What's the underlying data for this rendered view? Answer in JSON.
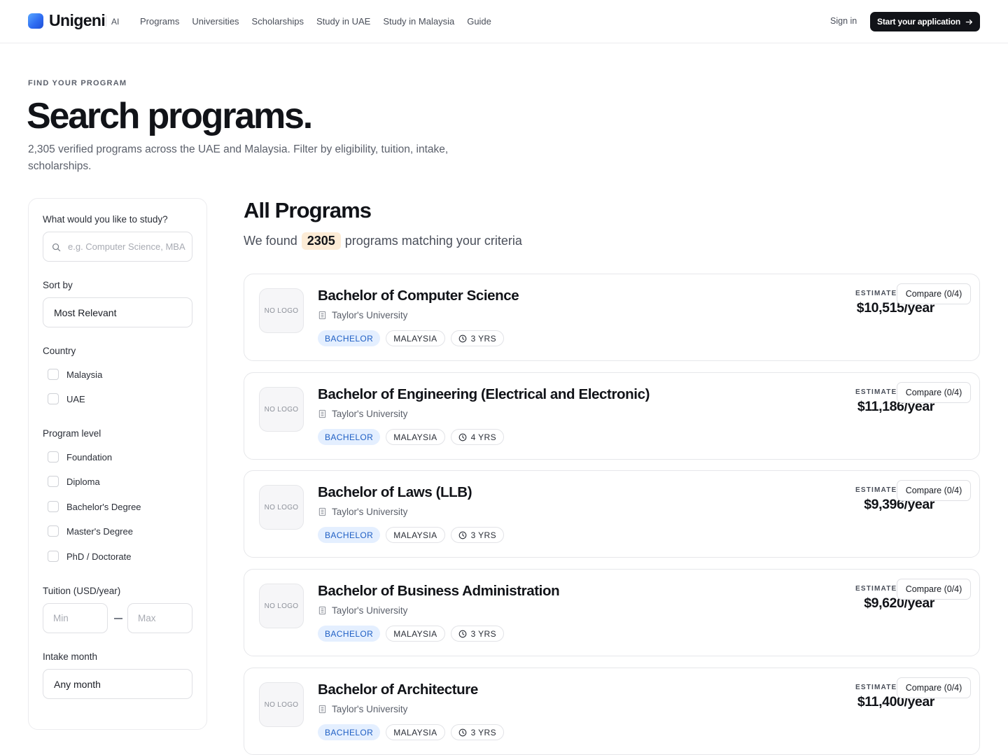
{
  "nav": {
    "brand": "Unigeni",
    "brand_suffix": "AI",
    "links": [
      "Programs",
      "Universities",
      "Scholarships",
      "Study in UAE",
      "Study in Malaysia",
      "Guide"
    ],
    "sign_in": "Sign in",
    "cta": "Start your application"
  },
  "hero": {
    "eyebrow": "FIND YOUR PROGRAM",
    "title": "Search programs.",
    "subtitle": "2,305 verified programs across the UAE and Malaysia. Filter by eligibility, tuition, intake, scholarships."
  },
  "filters": {
    "study_label": "What would you like to study?",
    "study_placeholder": "e.g. Computer Science, MBA",
    "sort_label": "Sort by",
    "sort_value": "Most Relevant",
    "country_label": "Country",
    "countries": [
      "Malaysia",
      "UAE"
    ],
    "level_label": "Program level",
    "levels": [
      "Foundation",
      "Diploma",
      "Bachelor's Degree",
      "Master's Degree",
      "PhD / Doctorate"
    ],
    "tuition_label": "Tuition (USD/year)",
    "tuition_min_placeholder": "Min",
    "tuition_max_placeholder": "Max",
    "intake_label": "Intake month",
    "intake_value": "Any month"
  },
  "results": {
    "title": "All Programs",
    "found_prefix": "We found",
    "count": "2305",
    "found_suffix": "programs matching your criteria",
    "estimated_label": "ESTIMATED",
    "compare_label": "Compare (0/4)",
    "no_logo": "NO LOGO",
    "programs": [
      {
        "title": "Bachelor of Computer Science",
        "university": "Taylor's University",
        "level": "BACHELOR",
        "country": "MALAYSIA",
        "duration": "3 YRS",
        "price": "$10,515/year"
      },
      {
        "title": "Bachelor of Engineering (Electrical and Electronic)",
        "university": "Taylor's University",
        "level": "BACHELOR",
        "country": "MALAYSIA",
        "duration": "4 YRS",
        "price": "$11,186/year"
      },
      {
        "title": "Bachelor of Laws (LLB)",
        "university": "Taylor's University",
        "level": "BACHELOR",
        "country": "MALAYSIA",
        "duration": "3 YRS",
        "price": "$9,396/year"
      },
      {
        "title": "Bachelor of Business Administration",
        "university": "Taylor's University",
        "level": "BACHELOR",
        "country": "MALAYSIA",
        "duration": "3 YRS",
        "price": "$9,620/year"
      },
      {
        "title": "Bachelor of Architecture",
        "university": "Taylor's University",
        "level": "BACHELOR",
        "country": "MALAYSIA",
        "duration": "3 YRS",
        "price": "$11,400/year"
      }
    ]
  }
}
